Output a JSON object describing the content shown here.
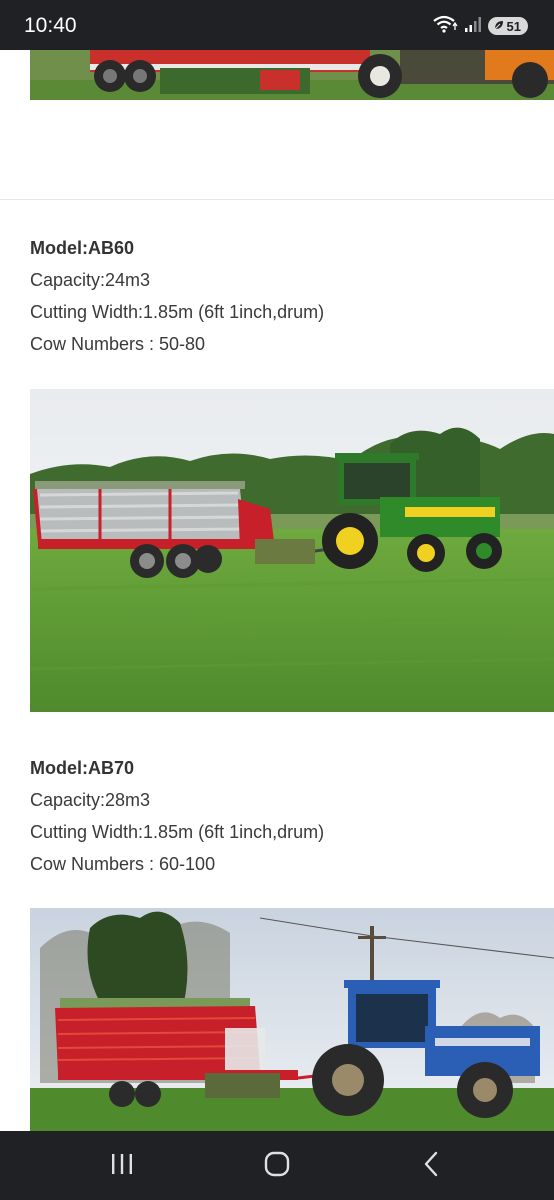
{
  "status_bar": {
    "time": "10:40",
    "battery": "51",
    "icons": [
      "wifi-icon",
      "signal-icon",
      "battery-saver-icon"
    ]
  },
  "models": [
    {
      "model": "Model:AB60",
      "capacity": "Capacity:24m3",
      "cutting_width": "Cutting Width:1.85m (6ft 1inch,drum)",
      "cow_numbers": "Cow Numbers : 50-80",
      "image": "red loader wagon towed by green tractor on grass field"
    },
    {
      "model": "Model:AB70",
      "capacity": "Capacity:28m3",
      "cutting_width": "Cutting Width:1.85m (6ft 1inch,drum)",
      "cow_numbers": "Cow Numbers : 60-100",
      "image": "red loader wagon towed by blue tractor on grass field"
    }
  ],
  "nav_bar": {
    "icons": [
      "recent-apps-icon",
      "home-icon",
      "back-icon"
    ]
  },
  "colors": {
    "system_bar": "#202124",
    "text": "#3a3a3a",
    "grass": "#5f9e3a",
    "wagon_red": "#c8202a",
    "tractor_green": "#2f7a2a",
    "tractor_blue": "#2a5fb5"
  }
}
